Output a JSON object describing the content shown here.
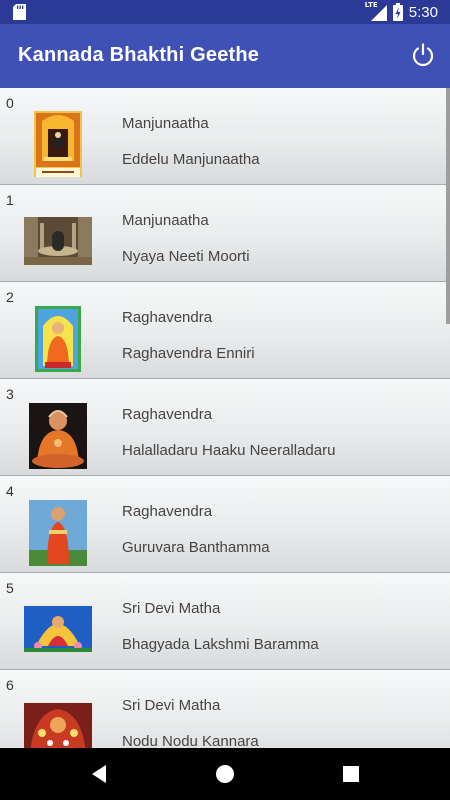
{
  "status_bar": {
    "time": "5:30",
    "network_label": "LTE",
    "icons": [
      "sd-card-icon",
      "signal-icon",
      "battery-charging-icon"
    ]
  },
  "app_bar": {
    "title": "Kannada Bhakthi Geethe",
    "action_icon": "power-icon"
  },
  "songs": [
    {
      "index": "0",
      "title": "Manjunaatha",
      "subtitle": "Eddelu Manjunaatha",
      "thumb": "temple-shrine-orange"
    },
    {
      "index": "1",
      "title": "Manjunaatha",
      "subtitle": "Nyaya Neeti Moorti",
      "thumb": "lingam-stone"
    },
    {
      "index": "2",
      "title": "Raghavendra",
      "subtitle": "Raghavendra Enniri",
      "thumb": "saint-blue-orange"
    },
    {
      "index": "3",
      "title": "Raghavendra",
      "subtitle": "Halalladaru Haaku Neeralladaru",
      "thumb": "saint-seated-dark"
    },
    {
      "index": "4",
      "title": "Raghavendra",
      "subtitle": "Guruvara Banthamma",
      "thumb": "saint-standing-red"
    },
    {
      "index": "5",
      "title": "Sri Devi Matha",
      "subtitle": "Bhagyada Lakshmi Baramma",
      "thumb": "lakshmi-blue"
    },
    {
      "index": "6",
      "title": "Sri Devi Matha",
      "subtitle": "Nodu Nodu Kannara",
      "thumb": "devi-flowers"
    }
  ],
  "nav_bar": {
    "icons": [
      "back-icon",
      "home-icon",
      "recents-icon"
    ]
  }
}
